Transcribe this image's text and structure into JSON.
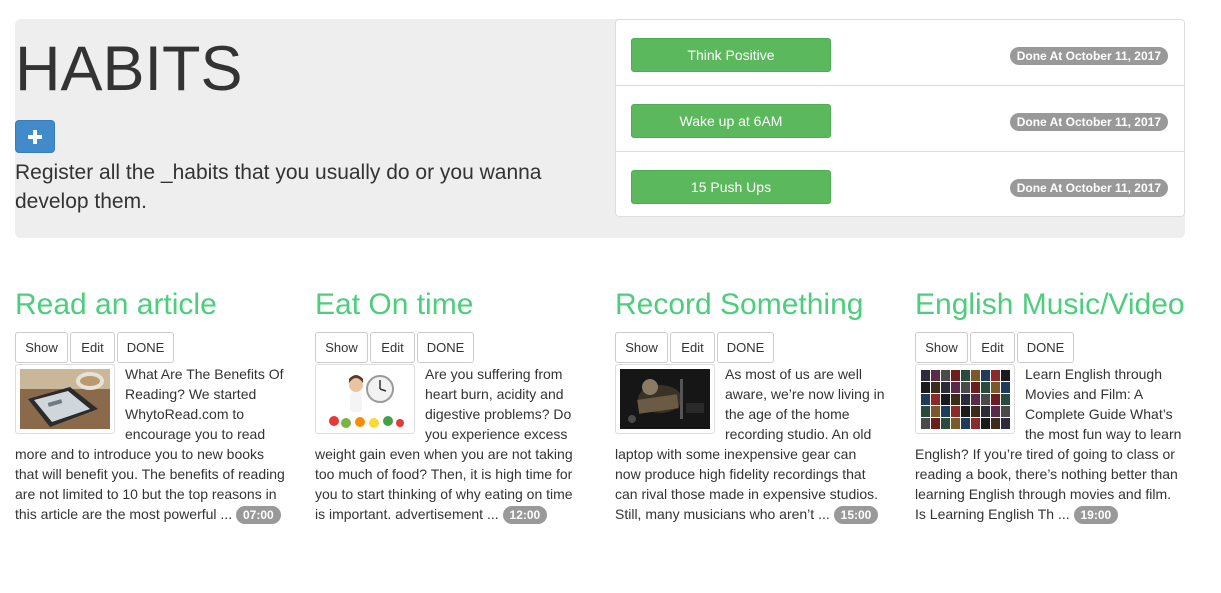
{
  "header": {
    "title": "HABITS",
    "add_button_icon": "plus-icon",
    "description": "Register all the _habits that you usually do or you wanna develop them."
  },
  "done_list": [
    {
      "label": "Think Positive",
      "badge": "Done At October 11, 2017"
    },
    {
      "label": "Wake up at 6AM",
      "badge": "Done At October 11, 2017"
    },
    {
      "label": "15 Push Ups",
      "badge": "Done At October 11, 2017"
    }
  ],
  "buttons": {
    "show": "Show",
    "edit": "Edit",
    "done": "DONE"
  },
  "cards": [
    {
      "title": "Read an article",
      "text": "What Are The Benefits Of Reading? We started WhytoRead.com to encourage you to read more and to introduce you to new books that will benefit you. The benefits of reading are not limited to 10 but the top reasons in this article are the most powerful ...",
      "time": "07:00",
      "thumb": "tablet-reading-thumbnail"
    },
    {
      "title": "Eat On time",
      "text": "Are you suffering from heart burn, acidity and digestive problems? Do you experience excess weight gain even when you are not taking too much of food? Then, it is high time for you to start thinking of why eating on time is important. advertisement ...",
      "time": "12:00",
      "thumb": "woman-clock-thumbnail"
    },
    {
      "title": "Record Something",
      "text": "As most of us are well aware, we’re now living in the age of the home recording studio. An old laptop with some inexpensive gear can now produce high fidelity recordings that can rival those made in expensive studios. Still, many musicians who aren’t ...",
      "time": "15:00",
      "thumb": "recording-studio-thumbnail"
    },
    {
      "title": "English Music/Video",
      "text": "Learn English through Movies and Film: A Complete Guide What’s the most fun way to learn English? If you’re tired of going to class or reading a book, there’s nothing better than learning English through movies and film. Is Learning English Th ...",
      "time": "19:00",
      "thumb": "movie-posters-thumbnail"
    }
  ],
  "colors": {
    "accent_green": "#4cce7c",
    "success": "#5cb85c",
    "primary": "#428bca",
    "badge": "#999999",
    "jumbotron": "#eeeeee"
  }
}
